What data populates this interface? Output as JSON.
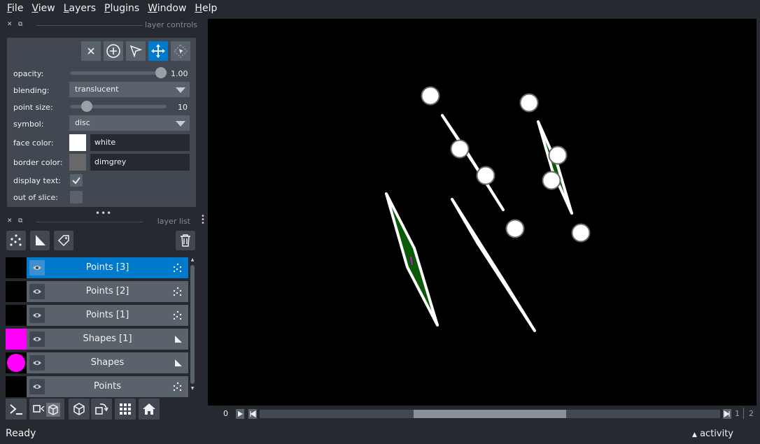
{
  "menu": [
    {
      "mnemonic": "F",
      "rest": "ile"
    },
    {
      "mnemonic": "V",
      "rest": "iew"
    },
    {
      "mnemonic": "L",
      "rest": "ayers"
    },
    {
      "mnemonic": "P",
      "rest": "lugins"
    },
    {
      "mnemonic": "W",
      "rest": "indow"
    },
    {
      "mnemonic": "H",
      "rest": "elp"
    }
  ],
  "layer_controls": {
    "title": "layer controls",
    "tools": [
      "close-icon",
      "add-point-icon",
      "select-icon",
      "pan-zoom-icon",
      "transform-icon"
    ],
    "opacity": {
      "label": "opacity:",
      "value": 1.0,
      "display": "1.00"
    },
    "blending": {
      "label": "blending:",
      "value": "translucent"
    },
    "point_size": {
      "label": "point size:",
      "value": 10,
      "min": 1,
      "max": 100,
      "display": "10"
    },
    "symbol": {
      "label": "symbol:",
      "value": "disc"
    },
    "face_color": {
      "label": "face color:",
      "value": "white",
      "swatch": "#ffffff"
    },
    "border_color": {
      "label": "border color:",
      "value": "dimgrey",
      "swatch": "#696969"
    },
    "display_text": {
      "label": "display text:",
      "checked": true
    },
    "out_of_slice": {
      "label": "out of slice:",
      "checked": false
    }
  },
  "layer_list": {
    "title": "layer list",
    "layers": [
      {
        "name": "Points [3]",
        "selected": true,
        "thumb": "#000000",
        "type": "points"
      },
      {
        "name": "Points [2]",
        "selected": false,
        "thumb": "#000000",
        "type": "points"
      },
      {
        "name": "Points [1]",
        "selected": false,
        "thumb": "#000000",
        "type": "points"
      },
      {
        "name": "Shapes [1]",
        "selected": false,
        "thumb": "#ff00ff",
        "type": "shapes"
      },
      {
        "name": "Shapes",
        "selected": false,
        "thumb": "#ff00ff",
        "type": "shapes"
      },
      {
        "name": "Points",
        "selected": false,
        "thumb": "#000000",
        "type": "points"
      }
    ]
  },
  "dims": {
    "current": "0",
    "slider_value": "1",
    "slider_max": "2"
  },
  "status": {
    "text": "Ready",
    "activity": "activity"
  },
  "colors": {
    "accent": "#007acc",
    "shape_fill": "#005500",
    "shape_edge": "#ffffff",
    "shape_magenta": "#ff00ff"
  }
}
